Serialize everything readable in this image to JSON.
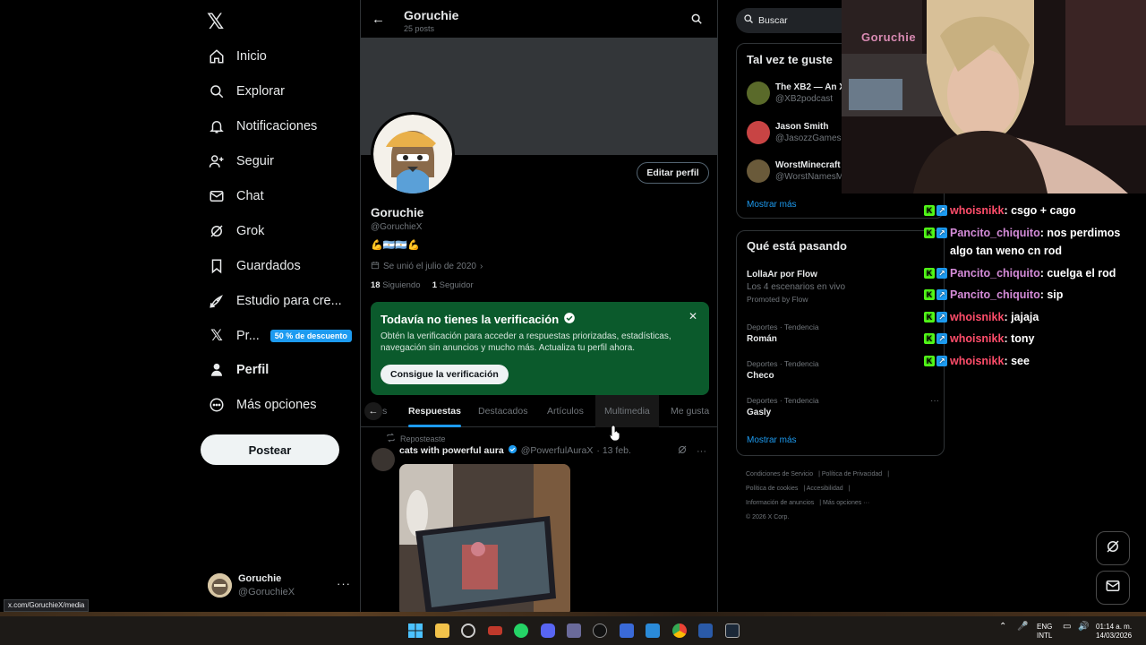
{
  "nav": {
    "items": [
      {
        "label": "Inicio",
        "icon": "home-icon"
      },
      {
        "label": "Explorar",
        "icon": "search-icon"
      },
      {
        "label": "Notificaciones",
        "icon": "bell-icon"
      },
      {
        "label": "Seguir",
        "icon": "follow-icon"
      },
      {
        "label": "Chat",
        "icon": "mail-icon"
      },
      {
        "label": "Grok",
        "icon": "grok-icon"
      },
      {
        "label": "Guardados",
        "icon": "bookmark-icon"
      },
      {
        "label": "Estudio para cre...",
        "icon": "rocket-icon"
      },
      {
        "label": "Pr...",
        "icon": "x-icon",
        "badge": "50 % de descuento"
      },
      {
        "label": "Perfil",
        "icon": "person-icon"
      },
      {
        "label": "Más opciones",
        "icon": "more-circle-icon"
      }
    ],
    "post_button": "Postear",
    "account": {
      "name": "Goruchie",
      "handle": "@GoruchieX"
    }
  },
  "header": {
    "name": "Goruchie",
    "posts": "25 posts"
  },
  "profile": {
    "edit_button": "Editar perfil",
    "name": "Goruchie",
    "handle": "@GoruchieX",
    "bio": "💪🇦🇷🇦🇷💪",
    "joined": "Se unió el julio de 2020",
    "following_count": "18",
    "following_label": "Siguiendo",
    "followers_count": "1",
    "followers_label": "Seguidor"
  },
  "verification": {
    "title": "Todavía no tienes la verificación",
    "description": "Obtén la verificación para acceder a respuestas priorizadas, estadísticas, navegación sin anuncios y mucho más. Actualiza tu perfil ahora.",
    "button": "Consigue la verificación"
  },
  "tabs": [
    "s",
    "Respuestas",
    "Destacados",
    "Artículos",
    "Multimedia",
    "Me gusta"
  ],
  "tweet": {
    "repost_label": "Reposteaste",
    "author": "cats with powerful aura",
    "handle": "@PowerfulAuraX",
    "date": "· 13 feb."
  },
  "right": {
    "search_placeholder": "Buscar",
    "who_to_follow": {
      "title": "Tal vez te guste",
      "accounts": [
        {
          "name": "The XB2 — An X",
          "handle": "@XB2podcast"
        },
        {
          "name": "Jason Smith",
          "handle": "@JasozzGames"
        },
        {
          "name": "WorstMinecraft",
          "handle": "@WorstNamesM"
        }
      ],
      "show_more": "Mostrar más"
    },
    "trends": {
      "title": "Qué está pasando",
      "promoted": {
        "title": "LollaAr por Flow",
        "subtitle": "Los 4 escenarios en vivo",
        "tag": "Promoted by Flow"
      },
      "items": [
        {
          "category": "Deportes · Tendencia",
          "name": "Román"
        },
        {
          "category": "Deportes · Tendencia",
          "name": "Checo"
        },
        {
          "category": "Deportes · Tendencia",
          "name": "Gasly"
        }
      ],
      "show_more": "Mostrar más"
    },
    "footer": [
      "Condiciones de Servicio",
      "Política de Privacidad",
      "Política de cookies",
      "Accesibilidad",
      "Información de anuncios",
      "Más opciones ···",
      "© 2026 X Corp."
    ]
  },
  "stream": {
    "cam_title": "Goruchie",
    "chat": [
      {
        "user": "whoisnikk",
        "text": ": csgo + cago",
        "color": "#ff4d6a"
      },
      {
        "user": "Pancito_chiquito",
        "text": ": nos perdimos algo tan weno cn rod",
        "color": "#d48bd8"
      },
      {
        "user": "Pancito_chiquito",
        "text": ": cuelga el rod",
        "color": "#d48bd8"
      },
      {
        "user": "Pancito_chiquito",
        "text": ": sip",
        "color": "#d48bd8"
      },
      {
        "user": "whoisnikk",
        "text": ": jajaja",
        "color": "#ff4d6a"
      },
      {
        "user": "whoisnikk",
        "text": ": tony",
        "color": "#ff4d6a"
      },
      {
        "user": "whoisnikk",
        "text": ": see",
        "color": "#ff4d6a"
      }
    ]
  },
  "status_url": "x.com/GoruchieX/media",
  "taskbar": {
    "lang": "ENG",
    "layout": "INTL",
    "time": "01:14 a. m.",
    "date": "14/03/2026"
  },
  "colors": {
    "accent": "#1d9bf0",
    "verify_bg": "#0b5a2c",
    "bg": "#000000"
  }
}
